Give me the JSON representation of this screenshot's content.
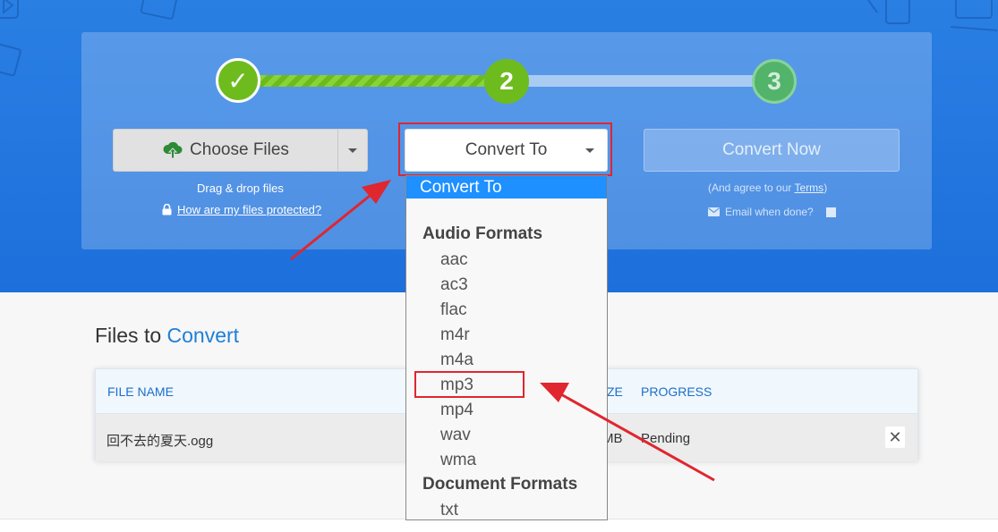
{
  "steps": {
    "step1_symbol": "✓",
    "step2_number": "2",
    "step3_number": "3"
  },
  "upload": {
    "choose_files": "Choose Files",
    "drag_drop": "Drag & drop files",
    "protected_link": "How are my files protected?"
  },
  "convert_to": {
    "label": "Convert To"
  },
  "convert_now": {
    "label": "Convert Now",
    "terms_prefix": "(And agree to our ",
    "terms_link": "Terms",
    "terms_suffix": ")",
    "email_label": "Email when done?"
  },
  "dropdown": {
    "selected": "Convert To",
    "groups": [
      {
        "label": "Audio Formats",
        "options": [
          "aac",
          "ac3",
          "flac",
          "m4r",
          "m4a",
          "mp3",
          "mp4",
          "wav",
          "wma"
        ]
      },
      {
        "label": "Document Formats",
        "options": [
          "txt"
        ]
      }
    ],
    "highlighted_option": "mp3"
  },
  "files": {
    "title_prefix": "Files to ",
    "title_accent": "Convert",
    "columns": [
      "FILE NAME",
      "ZE",
      "PROGRESS"
    ],
    "rows": [
      {
        "name": "回不去的夏天.ogg",
        "size": "MB",
        "progress": "Pending"
      }
    ],
    "remove_symbol": "✕"
  },
  "colors": {
    "hero_blue": "#1d6fdb",
    "step_green": "#6ebb1e",
    "accent_blue": "#1d7fd9",
    "highlight_red": "#e0262f",
    "dropdown_selected": "#1e90ff"
  }
}
